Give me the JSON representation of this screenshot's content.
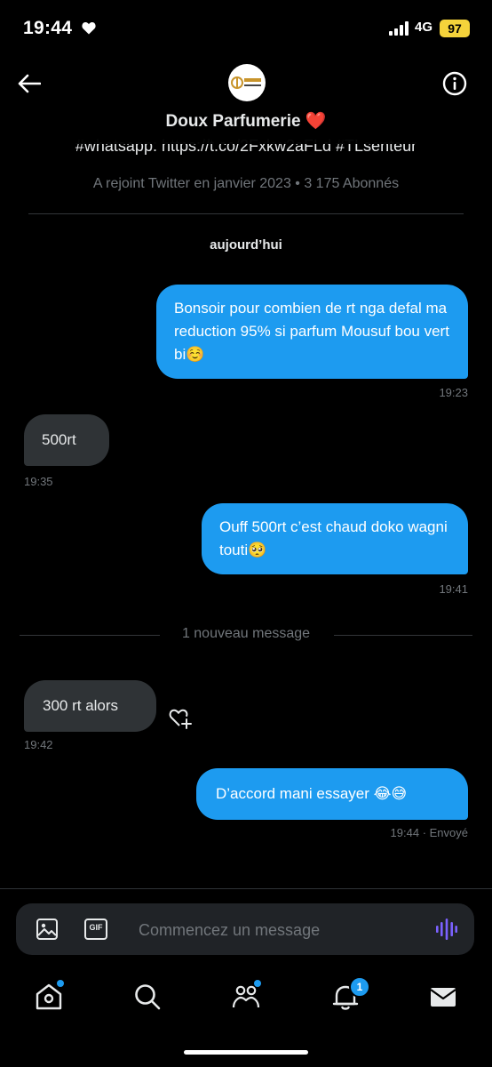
{
  "status_bar": {
    "time": "19:44",
    "network": "4G",
    "battery": "97"
  },
  "header": {
    "back_icon": "arrow-left-icon",
    "contact_name": "Doux Parfumerie ❤️",
    "avatar_text": "DOUX PARFUMERIE",
    "info_icon": "info-icon"
  },
  "profile": {
    "bio": "#whatsapp: https://t.co/2Fxkw2aFLd #TLsenteur",
    "joined": "A rejoint Twitter en janvier 2023 • 3 175 Abonnés"
  },
  "conversation": {
    "day_label": "aujourd’hui",
    "new_message_label": "1 nouveau message",
    "messages": [
      {
        "direction": "out",
        "text": "Bonsoir pour combien de rt nga defal ma reduction 95% si parfum Mousuf bou vert bi☺️",
        "time": "19:23"
      },
      {
        "direction": "in",
        "text": "500rt",
        "time": "19:35"
      },
      {
        "direction": "out",
        "text": "Ouff 500rt c’est chaud doko wagni touti🥺",
        "time": "19:41"
      },
      {
        "direction": "in",
        "text": "300 rt alors",
        "time": "19:42"
      },
      {
        "direction": "out",
        "text": "D’accord mani essayer 😂😅",
        "time": "19:44 · Envoyé"
      }
    ]
  },
  "composer": {
    "placeholder": "Commencez un message",
    "gif_label": "GIF"
  },
  "bottom_nav": {
    "notification_count": "1"
  },
  "colors": {
    "accent": "#1d9bf0",
    "incoming_bubble": "#2f3336",
    "background": "#000000",
    "muted_text": "#71767b",
    "voice_icon": "#7b61ff"
  }
}
